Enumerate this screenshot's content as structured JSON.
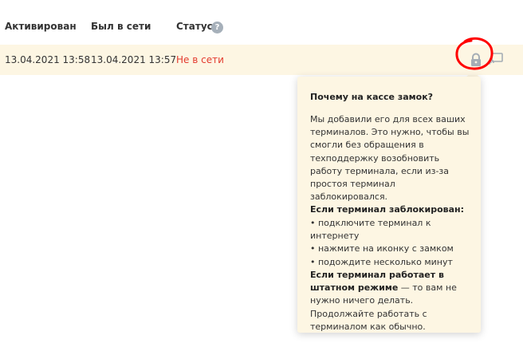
{
  "table": {
    "headers": {
      "activated": "Активирован",
      "last_seen": "Был в сети",
      "status": "Статус"
    },
    "help_icon_glyph": "?",
    "row": {
      "activated": "13.04.2021 13:58",
      "last_seen": "13.04.2021 13:57",
      "status": "Не в сети"
    }
  },
  "icons": {
    "lock": "lock-icon",
    "remote": "remote-screen-icon",
    "help": "question-circle-icon"
  },
  "colors": {
    "status_offline": "#e33b2e",
    "row_bg": "#fdf6e3",
    "annotation": "#ff0000"
  },
  "tooltip": {
    "title": "Почему на кассе замок?",
    "intro": "Мы добавили его для всех ваших терминалов. Это нужно, чтобы вы смогли без обращения в техподдержку возобновить работу терминала, если из-за простоя терминал заблокировался.",
    "locked_heading": "Если терминал заблокирован:",
    "steps": [
      "• подключите терминал к интернету",
      "• нажмите на иконку с замком",
      "• подождите несколько минут"
    ],
    "normal_bold": "Если терминал работает в штатном режиме",
    "normal_rest": " — то вам не нужно ничего делать. Продолжайте работать с терминалом как обычно."
  }
}
